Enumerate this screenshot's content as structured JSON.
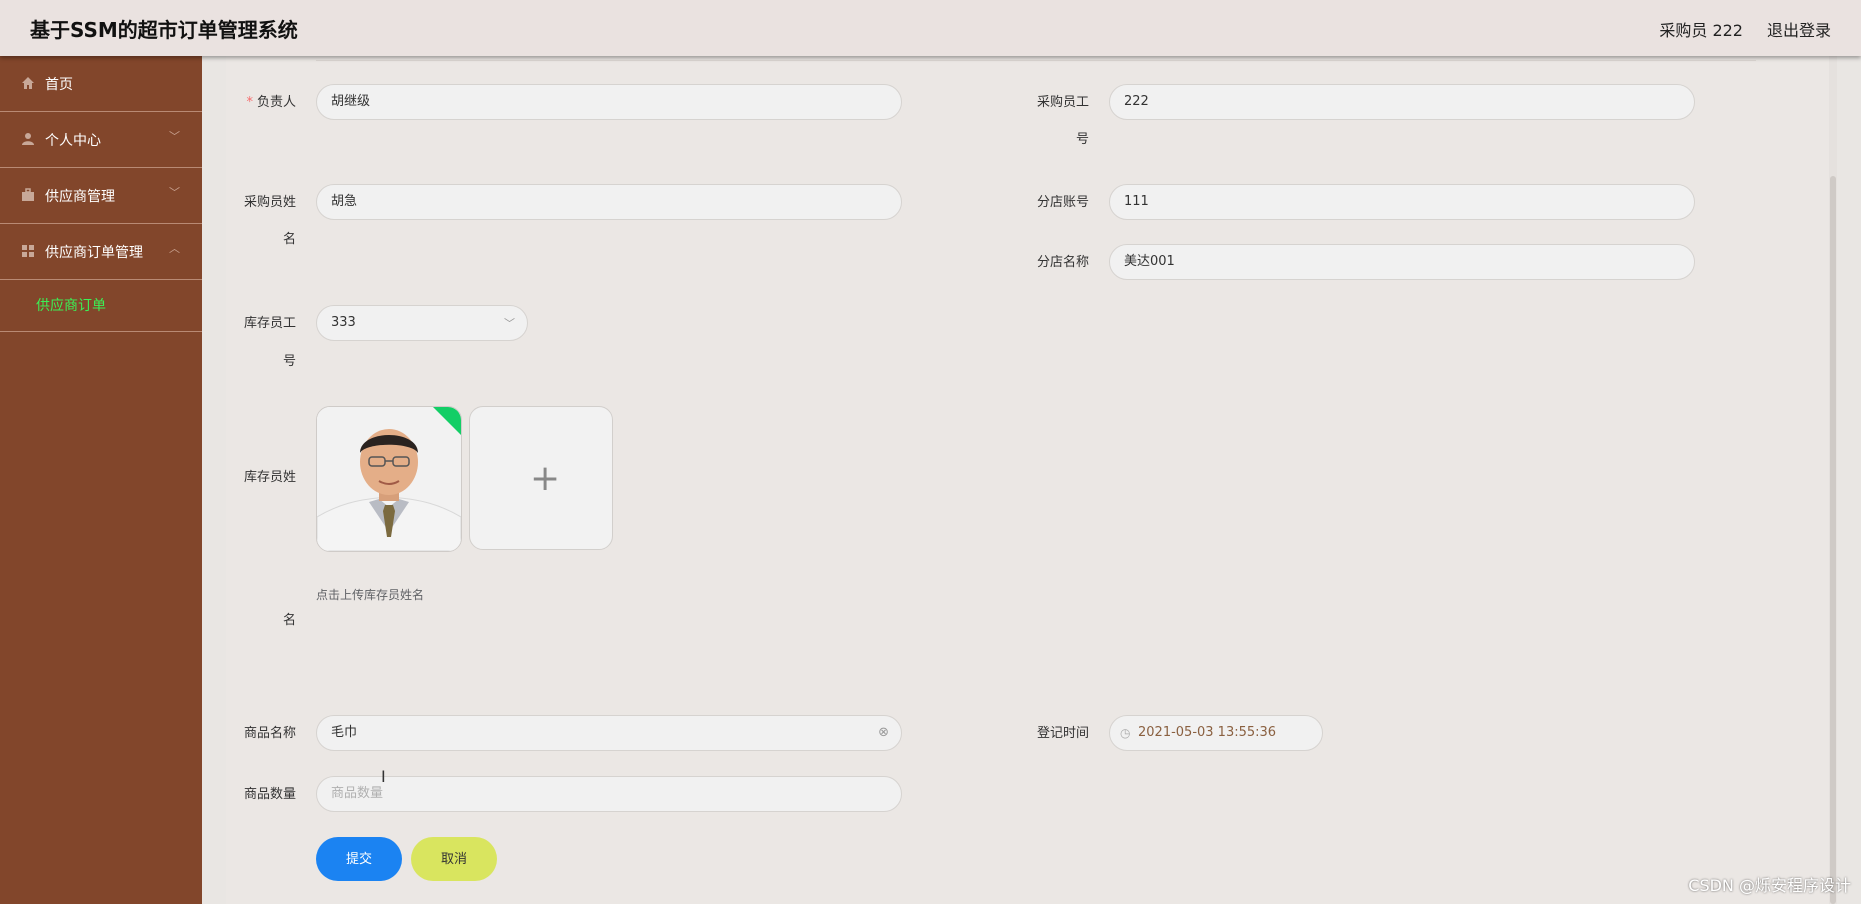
{
  "header": {
    "title": "基于SSM的超市订单管理系统",
    "user": "采购员 222",
    "logout": "退出登录"
  },
  "sidebar": {
    "items": [
      {
        "label": "首页",
        "icon": "home-icon"
      },
      {
        "label": "个人中心",
        "icon": "user-icon"
      },
      {
        "label": "供应商管理",
        "icon": "briefcase-icon"
      },
      {
        "label": "供应商订单管理",
        "icon": "grid-icon"
      }
    ],
    "subitem": "供应商订单"
  },
  "form": {
    "manager": {
      "label": "负责人",
      "value": "胡继级"
    },
    "buyer_id": {
      "label_line1": "采购员工",
      "label_line2": "号",
      "value": "222"
    },
    "buyer_name": {
      "label_line1": "采购员姓",
      "label_line2": "名",
      "value": "胡急"
    },
    "branch_account": {
      "label": "分店账号",
      "value": "111"
    },
    "branch_name": {
      "label": "分店名称",
      "value": "美达001"
    },
    "stock_id": {
      "label_line1": "库存员工",
      "label_line2": "号",
      "value": "333"
    },
    "stock_name": {
      "label_line1": "库存员姓",
      "label_line2": "名",
      "tip": "点击上传库存员姓名"
    },
    "product_name": {
      "label": "商品名称",
      "value": "毛巾"
    },
    "register_time": {
      "label": "登记时间",
      "value": "2021-05-03 13:55:36"
    },
    "product_qty": {
      "label": "商品数量",
      "placeholder": "商品数量"
    },
    "submit": "提交",
    "cancel": "取消"
  },
  "watermark": "CSDN @烁安程序设计",
  "colors": {
    "sidebar": "#82462b",
    "active_sub": "#3cf055",
    "submit": "#1b83f2",
    "cancel": "#d9e55f",
    "required": "#f56c6c"
  }
}
